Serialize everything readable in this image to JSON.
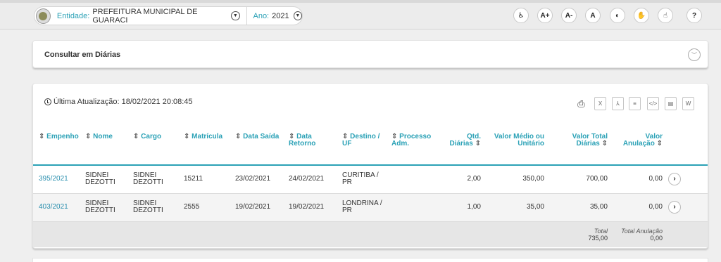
{
  "header": {
    "entidade_label": "Entidade:",
    "entidade_value": "PREFEITURA MUNICIPAL DE GUARACI",
    "ano_label": "Ano:",
    "ano_value": "2021",
    "accessibility": [
      {
        "name": "wheelchair-icon",
        "glyph": "♿"
      },
      {
        "name": "font-increase-icon",
        "glyph": "A+"
      },
      {
        "name": "font-decrease-icon",
        "glyph": "A-"
      },
      {
        "name": "font-reset-icon",
        "glyph": "A"
      },
      {
        "name": "contrast-icon",
        "glyph": "◐"
      },
      {
        "name": "sign-language-icon",
        "glyph": "✋"
      },
      {
        "name": "libras-hand-icon",
        "glyph": "☝"
      },
      {
        "name": "help-icon",
        "glyph": "?"
      }
    ]
  },
  "query_panel": {
    "title": "Consultar em Diárias",
    "expand_glyph": "﹀"
  },
  "results": {
    "updated": "Última Atualização: 18/02/2021 20:08:45",
    "export_icons": [
      {
        "name": "print-icon",
        "glyph": "⎙"
      },
      {
        "name": "excel-icon",
        "glyph": "X"
      },
      {
        "name": "pdf-icon",
        "glyph": "⅄"
      },
      {
        "name": "text-icon",
        "glyph": "≡"
      },
      {
        "name": "xml-icon",
        "glyph": "</>"
      },
      {
        "name": "csv-icon",
        "glyph": "▤"
      },
      {
        "name": "word-icon",
        "glyph": "W"
      }
    ],
    "columns": [
      {
        "label": "Empenho",
        "sort": true,
        "align": "left"
      },
      {
        "label": "Nome",
        "sort": true,
        "align": "left"
      },
      {
        "label": "Cargo",
        "sort": true,
        "align": "left"
      },
      {
        "label": "Matrícula",
        "sort": true,
        "align": "left"
      },
      {
        "label": "Data Saída",
        "sort": true,
        "align": "left"
      },
      {
        "label": "Data Retorno",
        "sort": true,
        "align": "left"
      },
      {
        "label": "Destino / UF",
        "sort": true,
        "align": "left"
      },
      {
        "label": "Processo Adm.",
        "sort": true,
        "align": "left"
      },
      {
        "label": "Qtd. Diárias",
        "sort": true,
        "align": "right"
      },
      {
        "label": "Valor Médio ou Unitário",
        "sort": false,
        "align": "right"
      },
      {
        "label": "Valor Total Diárias",
        "sort": true,
        "align": "right"
      },
      {
        "label": "Valor Anulação",
        "sort": true,
        "align": "right"
      }
    ],
    "rows": [
      {
        "empenho": "395/2021",
        "nome": "SIDNEI DEZOTTI",
        "cargo": "SIDNEI DEZOTTI",
        "matricula": "15211",
        "saida": "23/02/2021",
        "retorno": "24/02/2021",
        "destino": "CURITIBA / PR",
        "processo": "",
        "qtd": "2,00",
        "medio": "350,00",
        "total": "700,00",
        "anulacao": "0,00"
      },
      {
        "empenho": "403/2021",
        "nome": "SIDNEI DEZOTTI",
        "cargo": "SIDNEI DEZOTTI",
        "matricula": "2555",
        "saida": "19/02/2021",
        "retorno": "19/02/2021",
        "destino": "LONDRINA / PR",
        "processo": "",
        "qtd": "1,00",
        "medio": "35,00",
        "total": "35,00",
        "anulacao": "0,00"
      }
    ],
    "footer": {
      "total_label": "Total",
      "total_value": "735,00",
      "anulacao_label": "Total Anulação",
      "anulacao_value": "0,00"
    }
  }
}
